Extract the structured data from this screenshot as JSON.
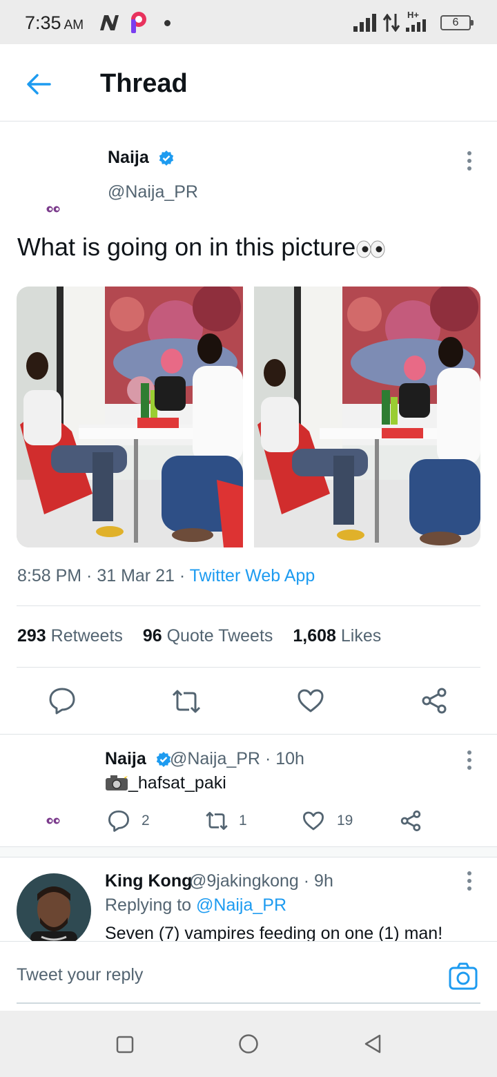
{
  "status_bar": {
    "time": "7:35",
    "ampm": "AM",
    "network": "H+",
    "battery": "6"
  },
  "header": {
    "title": "Thread"
  },
  "main_tweet": {
    "name": "Naija",
    "handle": "@Naija_PR",
    "text": "What is going on in this picture",
    "time": "8:58 PM",
    "date": "31 Mar 21",
    "source": "Twitter Web App",
    "retweets_count": "293",
    "retweets_label": "Retweets",
    "quotes_count": "96",
    "quotes_label": "Quote Tweets",
    "likes_count": "1,608",
    "likes_label": "Likes"
  },
  "reply1": {
    "name": "Naija",
    "handle": "@Naija_PR",
    "time": "· 10h",
    "text": "_hafsat_paki",
    "replies": "2",
    "retweets": "1",
    "likes": "19"
  },
  "reply2": {
    "name": "King Kong",
    "handle": "@9jakingkong",
    "time": "· 9h",
    "replying_prefix": "Replying to",
    "replying_to": "@Naija_PR",
    "text": "Seven (7) vampires feeding on one (1) man!"
  },
  "composer": {
    "placeholder": "Tweet your reply"
  },
  "colors": {
    "accent": "#1d9bf0",
    "muted": "#536471"
  }
}
